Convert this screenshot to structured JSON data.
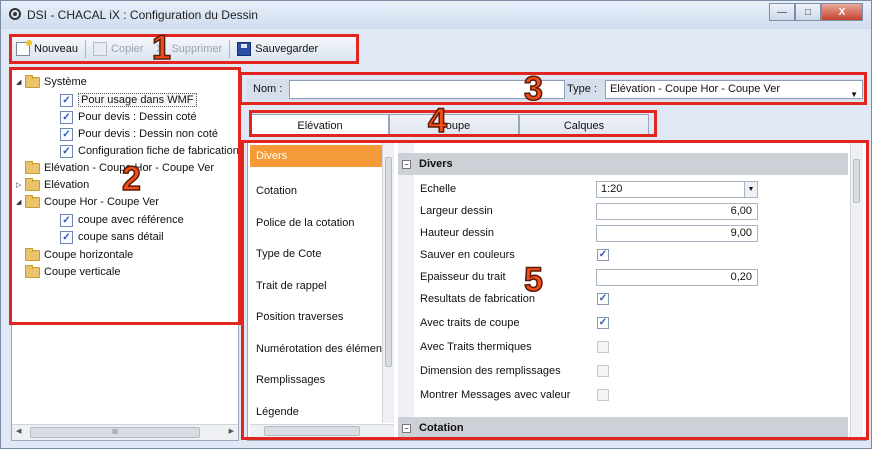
{
  "window": {
    "title": "DSI - CHACAL iX : Configuration du Dessin",
    "minimize": "—",
    "maximize": "□",
    "close": "X"
  },
  "toolbar": {
    "new_label": "Nouveau",
    "copy_label": "Copier",
    "delete_label": "Supprimer",
    "save_label": "Sauvegarder"
  },
  "tree": {
    "items": [
      {
        "label": "Système"
      },
      {
        "label": "Pour usage dans WMF"
      },
      {
        "label": "Pour devis : Dessin coté"
      },
      {
        "label": "Pour devis : Dessin non coté"
      },
      {
        "label": "Configuration fiche de fabrication"
      },
      {
        "label": "Elévation - Coupe Hor - Coupe Ver"
      },
      {
        "label": "Elévation"
      },
      {
        "label": "Coupe Hor - Coupe Ver"
      },
      {
        "label": "coupe avec référence"
      },
      {
        "label": "coupe sans détail"
      },
      {
        "label": "Coupe horizontale"
      },
      {
        "label": "Coupe verticale"
      }
    ],
    "scroll_label": "III"
  },
  "header": {
    "nom_label": "Nom :",
    "nom_value": "",
    "type_label": "Type :",
    "type_value": "Elévation - Coupe Hor - Coupe Ver"
  },
  "tabs": [
    "Elévation",
    "Coupe",
    "Calques"
  ],
  "categories": [
    "Divers",
    "Cotation",
    "Police de la cotation",
    "Type de Cote",
    "Trait de rappel",
    "Position traverses",
    "Numérotation des éléments",
    "Remplissages",
    "Légende"
  ],
  "properties": {
    "section_divers": "Divers",
    "section_cotation": "Cotation",
    "collapse_symbol": "−",
    "rows": [
      {
        "name": "Echelle",
        "value": "1:20",
        "kind": "select"
      },
      {
        "name": "Largeur dessin",
        "value": "6,00",
        "kind": "text"
      },
      {
        "name": "Hauteur dessin",
        "value": "9,00",
        "kind": "text"
      },
      {
        "name": "Sauver en couleurs",
        "value": "✓",
        "kind": "check"
      },
      {
        "name": "Epaisseur du trait",
        "value": "0,20",
        "kind": "text"
      },
      {
        "name": "Resultats de fabrication",
        "value": "✓",
        "kind": "check"
      },
      {
        "name": "Avec traits de coupe",
        "value": "✓",
        "kind": "check"
      },
      {
        "name": "Avec Traits thermiques",
        "value": "",
        "kind": "check"
      },
      {
        "name": "Dimension des remplissages",
        "value": "",
        "kind": "check"
      },
      {
        "name": "Montrer Messages avec valeur",
        "value": "",
        "kind": "check"
      }
    ]
  },
  "annotations": [
    "1",
    "2",
    "3",
    "4",
    "5"
  ],
  "colors": {
    "annotation_red": "#e0261f",
    "active_category": "#f59a38"
  }
}
